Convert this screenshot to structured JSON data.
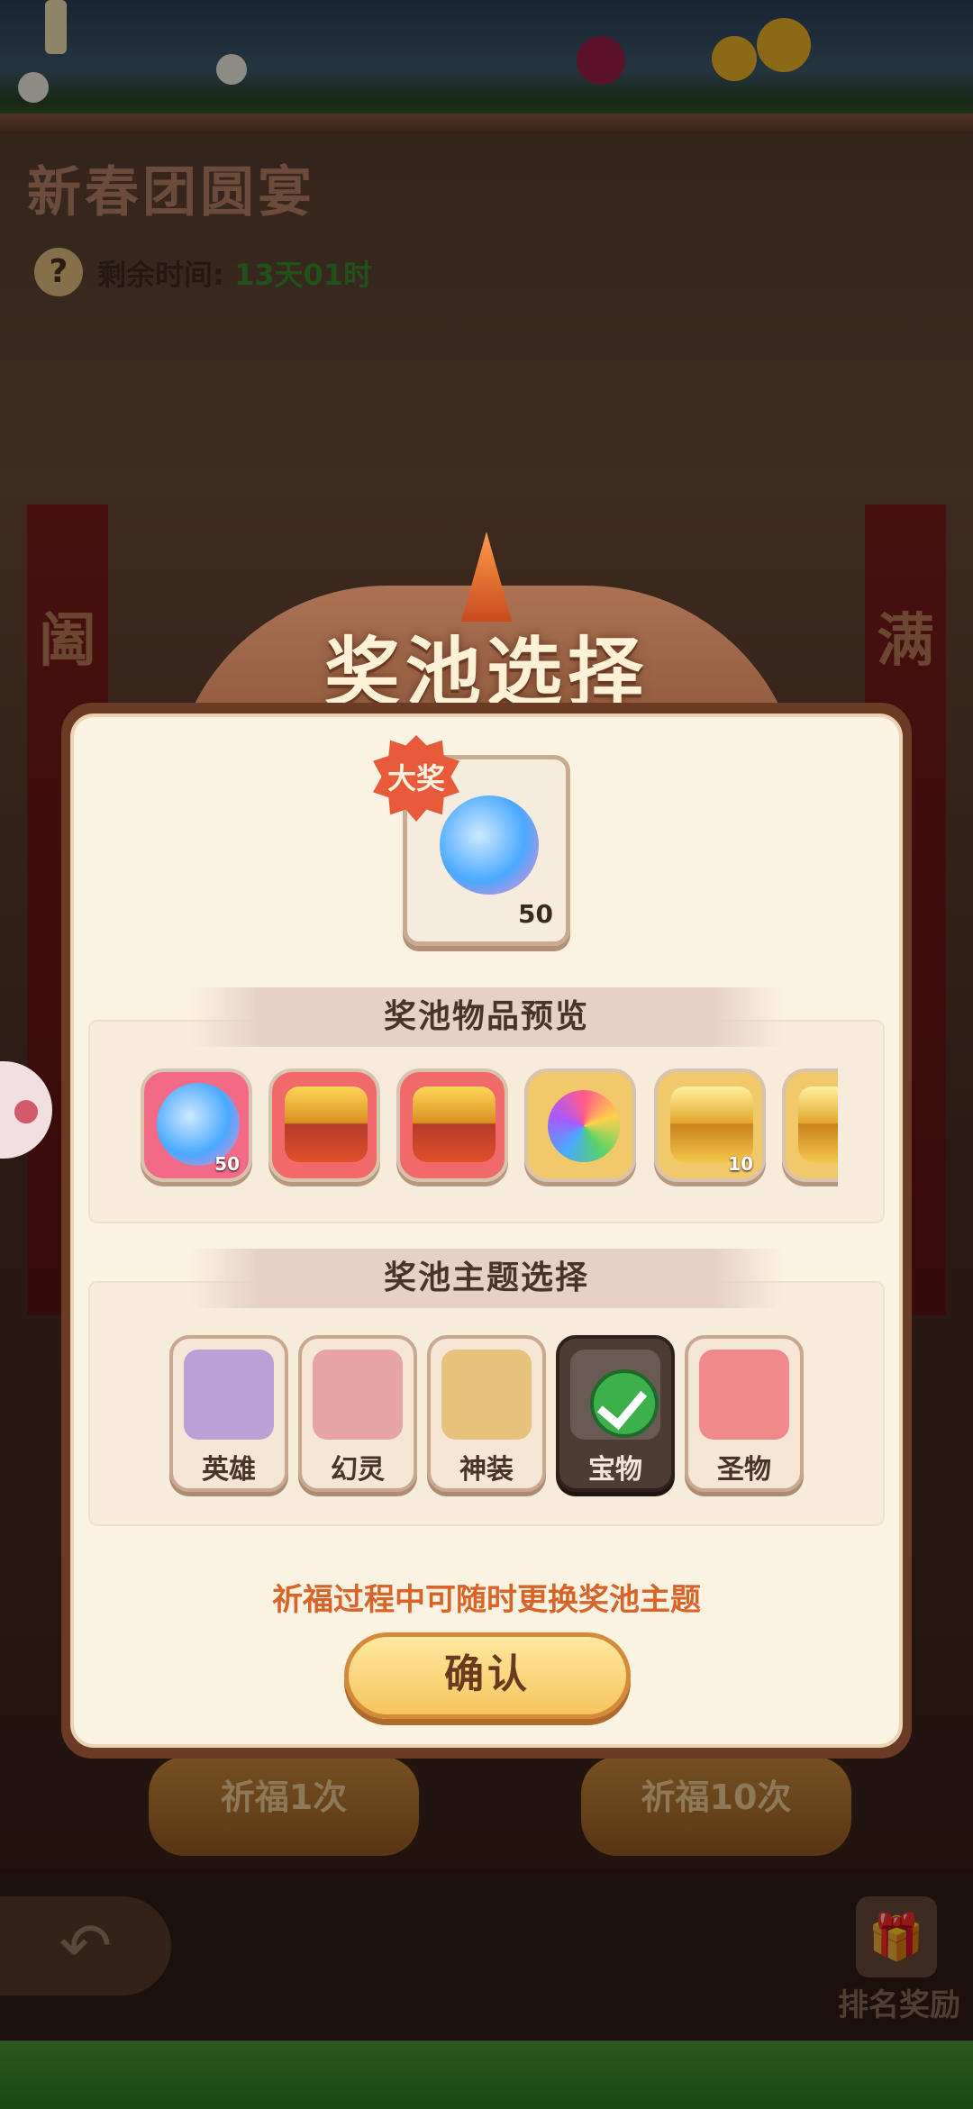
{
  "event": {
    "title": "新春团圆宴",
    "time_label": "剩余时间:",
    "time_value": "13天01时",
    "wish_once": "祈福1次",
    "wish_ten": "祈福10次",
    "banner_left": [
      "阖"
    ],
    "banner_right": [
      "满"
    ],
    "rank_label": "排名奖励"
  },
  "modal": {
    "title": "奖池选择",
    "grand_prize": {
      "badge": "大奖",
      "quantity": "50",
      "icon": "potion-icon"
    },
    "preview": {
      "header": "奖池物品预览",
      "items": [
        {
          "icon": "potion-icon",
          "quantity": "50",
          "color": "pink"
        },
        {
          "icon": "red-chest-icon",
          "quantity": "",
          "color": "red"
        },
        {
          "icon": "red-chest-icon",
          "quantity": "",
          "color": "red"
        },
        {
          "icon": "rainbow-key-icon",
          "quantity": "",
          "color": "gold"
        },
        {
          "icon": "gold-chest-icon",
          "quantity": "10",
          "color": "gold"
        },
        {
          "icon": "gold-chest-icon",
          "quantity": "",
          "color": "gold"
        }
      ]
    },
    "theme": {
      "header": "奖池主题选择",
      "options": [
        {
          "label": "英雄",
          "icon": "hero-emblem-icon",
          "selected": false
        },
        {
          "label": "幻灵",
          "icon": "spirit-chest-icon",
          "selected": false
        },
        {
          "label": "神装",
          "icon": "divine-gear-icon",
          "selected": false
        },
        {
          "label": "宝物",
          "icon": "check-icon",
          "selected": true
        },
        {
          "label": "圣物",
          "icon": "relic-chest-icon",
          "selected": false
        }
      ]
    },
    "hint": "祈福过程中可随时更换奖池主题",
    "confirm": "确认"
  }
}
